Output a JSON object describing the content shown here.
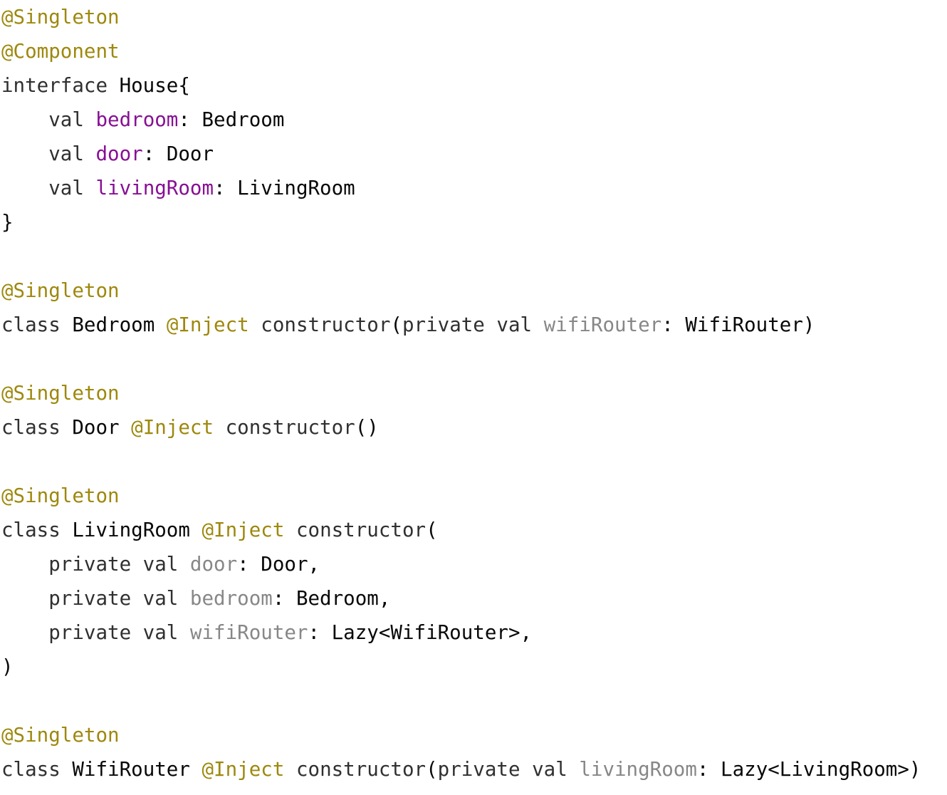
{
  "editor": {
    "language": "Kotlin",
    "colors": {
      "annotation": "#9e880d",
      "keyword": "#303030",
      "property": "#871094",
      "parameter": "#878787",
      "plain": "#080808",
      "background": "#ffffff"
    },
    "lines": [
      {
        "tokens": [
          {
            "t": "@Singleton",
            "c": "ann"
          }
        ]
      },
      {
        "tokens": [
          {
            "t": "@Component",
            "c": "ann"
          }
        ]
      },
      {
        "tokens": [
          {
            "t": "interface",
            "c": "kw"
          },
          {
            "t": " House{",
            "c": "plain"
          }
        ]
      },
      {
        "tokens": [
          {
            "t": "    ",
            "c": "plain"
          },
          {
            "t": "val",
            "c": "kw"
          },
          {
            "t": " ",
            "c": "plain"
          },
          {
            "t": "bedroom",
            "c": "prop"
          },
          {
            "t": ": Bedroom",
            "c": "plain"
          }
        ]
      },
      {
        "tokens": [
          {
            "t": "    ",
            "c": "plain"
          },
          {
            "t": "val",
            "c": "kw"
          },
          {
            "t": " ",
            "c": "plain"
          },
          {
            "t": "door",
            "c": "prop"
          },
          {
            "t": ": Door",
            "c": "plain"
          }
        ]
      },
      {
        "tokens": [
          {
            "t": "    ",
            "c": "plain"
          },
          {
            "t": "val",
            "c": "kw"
          },
          {
            "t": " ",
            "c": "plain"
          },
          {
            "t": "livingRoom",
            "c": "prop"
          },
          {
            "t": ": LivingRoom",
            "c": "plain"
          }
        ]
      },
      {
        "tokens": [
          {
            "t": "}",
            "c": "plain"
          }
        ]
      },
      {
        "tokens": []
      },
      {
        "tokens": [
          {
            "t": "@Singleton",
            "c": "ann"
          }
        ]
      },
      {
        "tokens": [
          {
            "t": "class",
            "c": "kw"
          },
          {
            "t": " Bedroom ",
            "c": "plain"
          },
          {
            "t": "@Inject",
            "c": "ann"
          },
          {
            "t": " ",
            "c": "plain"
          },
          {
            "t": "constructor",
            "c": "kw"
          },
          {
            "t": "(",
            "c": "plain"
          },
          {
            "t": "private val",
            "c": "kw"
          },
          {
            "t": " ",
            "c": "plain"
          },
          {
            "t": "wifiRouter",
            "c": "param"
          },
          {
            "t": ": WifiRouter)",
            "c": "plain"
          }
        ]
      },
      {
        "tokens": []
      },
      {
        "tokens": [
          {
            "t": "@Singleton",
            "c": "ann"
          }
        ]
      },
      {
        "tokens": [
          {
            "t": "class",
            "c": "kw"
          },
          {
            "t": " Door ",
            "c": "plain"
          },
          {
            "t": "@Inject",
            "c": "ann"
          },
          {
            "t": " ",
            "c": "plain"
          },
          {
            "t": "constructor",
            "c": "kw"
          },
          {
            "t": "()",
            "c": "plain"
          }
        ]
      },
      {
        "tokens": []
      },
      {
        "tokens": [
          {
            "t": "@Singleton",
            "c": "ann"
          }
        ]
      },
      {
        "tokens": [
          {
            "t": "class",
            "c": "kw"
          },
          {
            "t": " LivingRoom ",
            "c": "plain"
          },
          {
            "t": "@Inject",
            "c": "ann"
          },
          {
            "t": " ",
            "c": "plain"
          },
          {
            "t": "constructor",
            "c": "kw"
          },
          {
            "t": "(",
            "c": "plain"
          }
        ]
      },
      {
        "tokens": [
          {
            "t": "    ",
            "c": "plain"
          },
          {
            "t": "private val",
            "c": "kw"
          },
          {
            "t": " ",
            "c": "plain"
          },
          {
            "t": "door",
            "c": "param"
          },
          {
            "t": ": Door,",
            "c": "plain"
          }
        ]
      },
      {
        "tokens": [
          {
            "t": "    ",
            "c": "plain"
          },
          {
            "t": "private val",
            "c": "kw"
          },
          {
            "t": " ",
            "c": "plain"
          },
          {
            "t": "bedroom",
            "c": "param"
          },
          {
            "t": ": Bedroom,",
            "c": "plain"
          }
        ]
      },
      {
        "tokens": [
          {
            "t": "    ",
            "c": "plain"
          },
          {
            "t": "private val",
            "c": "kw"
          },
          {
            "t": " ",
            "c": "plain"
          },
          {
            "t": "wifiRouter",
            "c": "param"
          },
          {
            "t": ": Lazy<WifiRouter>,",
            "c": "plain"
          }
        ]
      },
      {
        "tokens": [
          {
            "t": ")",
            "c": "plain"
          }
        ]
      },
      {
        "tokens": []
      },
      {
        "tokens": [
          {
            "t": "@Singleton",
            "c": "ann"
          }
        ]
      },
      {
        "tokens": [
          {
            "t": "class",
            "c": "kw"
          },
          {
            "t": " WifiRouter ",
            "c": "plain"
          },
          {
            "t": "@Inject",
            "c": "ann"
          },
          {
            "t": " ",
            "c": "plain"
          },
          {
            "t": "constructor",
            "c": "kw"
          },
          {
            "t": "(",
            "c": "plain"
          },
          {
            "t": "private val",
            "c": "kw"
          },
          {
            "t": " ",
            "c": "plain"
          },
          {
            "t": "livingRoom",
            "c": "param"
          },
          {
            "t": ": Lazy<LivingRoom>)",
            "c": "plain"
          }
        ]
      }
    ]
  }
}
